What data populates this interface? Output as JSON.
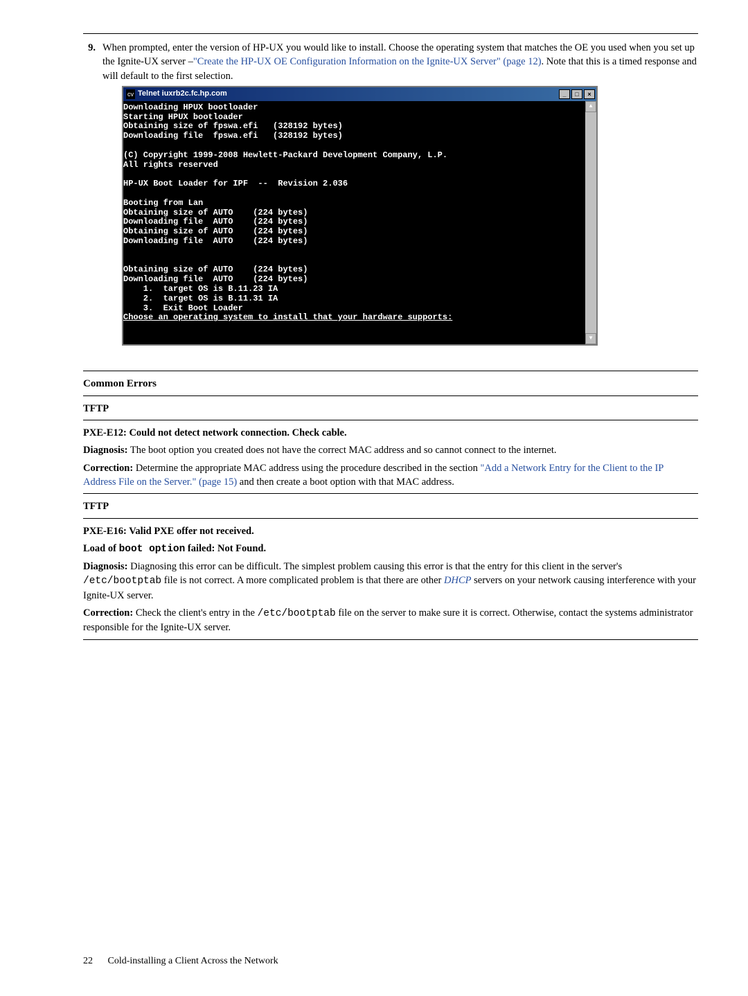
{
  "step": {
    "num": "9.",
    "text1": "When prompted, enter the version of HP-UX you would like to install. Choose the operating system that matches the OE you used when you set up the Ignite-UX server –",
    "link": "\"Create the HP-UX OE Configuration Information on the Ignite-UX Server\" (page 12)",
    "text2": ". Note that this is a timed response and will default to the first selection."
  },
  "terminal": {
    "title": "Telnet iuxrb2c.fc.hp.com",
    "cv": "cv",
    "min": "_",
    "max": "□",
    "close": "×",
    "up": "▲",
    "down": "▼",
    "body": "Downloading HPUX bootloader\nStarting HPUX bootloader\nObtaining size of fpswa.efi   (328192 bytes)\nDownloading file  fpswa.efi   (328192 bytes)\n\n(C) Copyright 1999-2008 Hewlett-Packard Development Company, L.P.\nAll rights reserved\n\nHP-UX Boot Loader for IPF  --  Revision 2.036\n\nBooting from Lan\nObtaining size of AUTO    (224 bytes)\nDownloading file  AUTO    (224 bytes)\nObtaining size of AUTO    (224 bytes)\nDownloading file  AUTO    (224 bytes)\n\n\nObtaining size of AUTO    (224 bytes)\nDownloading file  AUTO    (224 bytes)\n    1.  target OS is B.11.23 IA\n    2.  target OS is B.11.31 IA\n    3.  Exit Boot Loader\n",
    "lastline": "Choose an operating system to install that your hardware supports:"
  },
  "sec": {
    "common": "Common Errors",
    "tftp": "TFTP",
    "e12_title": "PXE-E12: Could not detect network connection. Check cable.",
    "e12_diag_b": "Diagnosis:",
    "e12_diag": " The boot option you created does not have the correct MAC address and so cannot connect to the internet.",
    "e12_corr_b": "Correction:",
    "e12_corr1": " Determine the appropriate MAC address using the procedure described in the section ",
    "e12_link": "\"Add a Network Entry for the Client to the IP Address File on the Server.\" (page 15)",
    "e12_corr2": " and then create a boot option with that MAC address.",
    "e16_title": "PXE-E16: Valid PXE offer not received.",
    "e16_load1": "Load of ",
    "e16_mono": "boot option",
    "e16_load2": " failed: Not Found.",
    "e16_diag_b": "Diagnosis:",
    "e16_diag1": " Diagnosing this error can be difficult. The simplest problem causing this error is that the entry for this client in the server's ",
    "e16_mono2": "/etc/bootptab",
    "e16_diag2": " file is not correct. A more complicated problem is that there are other ",
    "e16_dhcp": "DHCP",
    "e16_diag3": " servers on your network causing interference with your Ignite-UX server.",
    "e16_corr_b": "Correction:",
    "e16_corr1": " Check the client's entry in the ",
    "e16_corr2": " file on the server to make sure it is correct. Otherwise, contact the systems administrator responsible for the Ignite-UX server."
  },
  "footer": {
    "page": "22",
    "title": "Cold-installing a Client Across the Network"
  }
}
